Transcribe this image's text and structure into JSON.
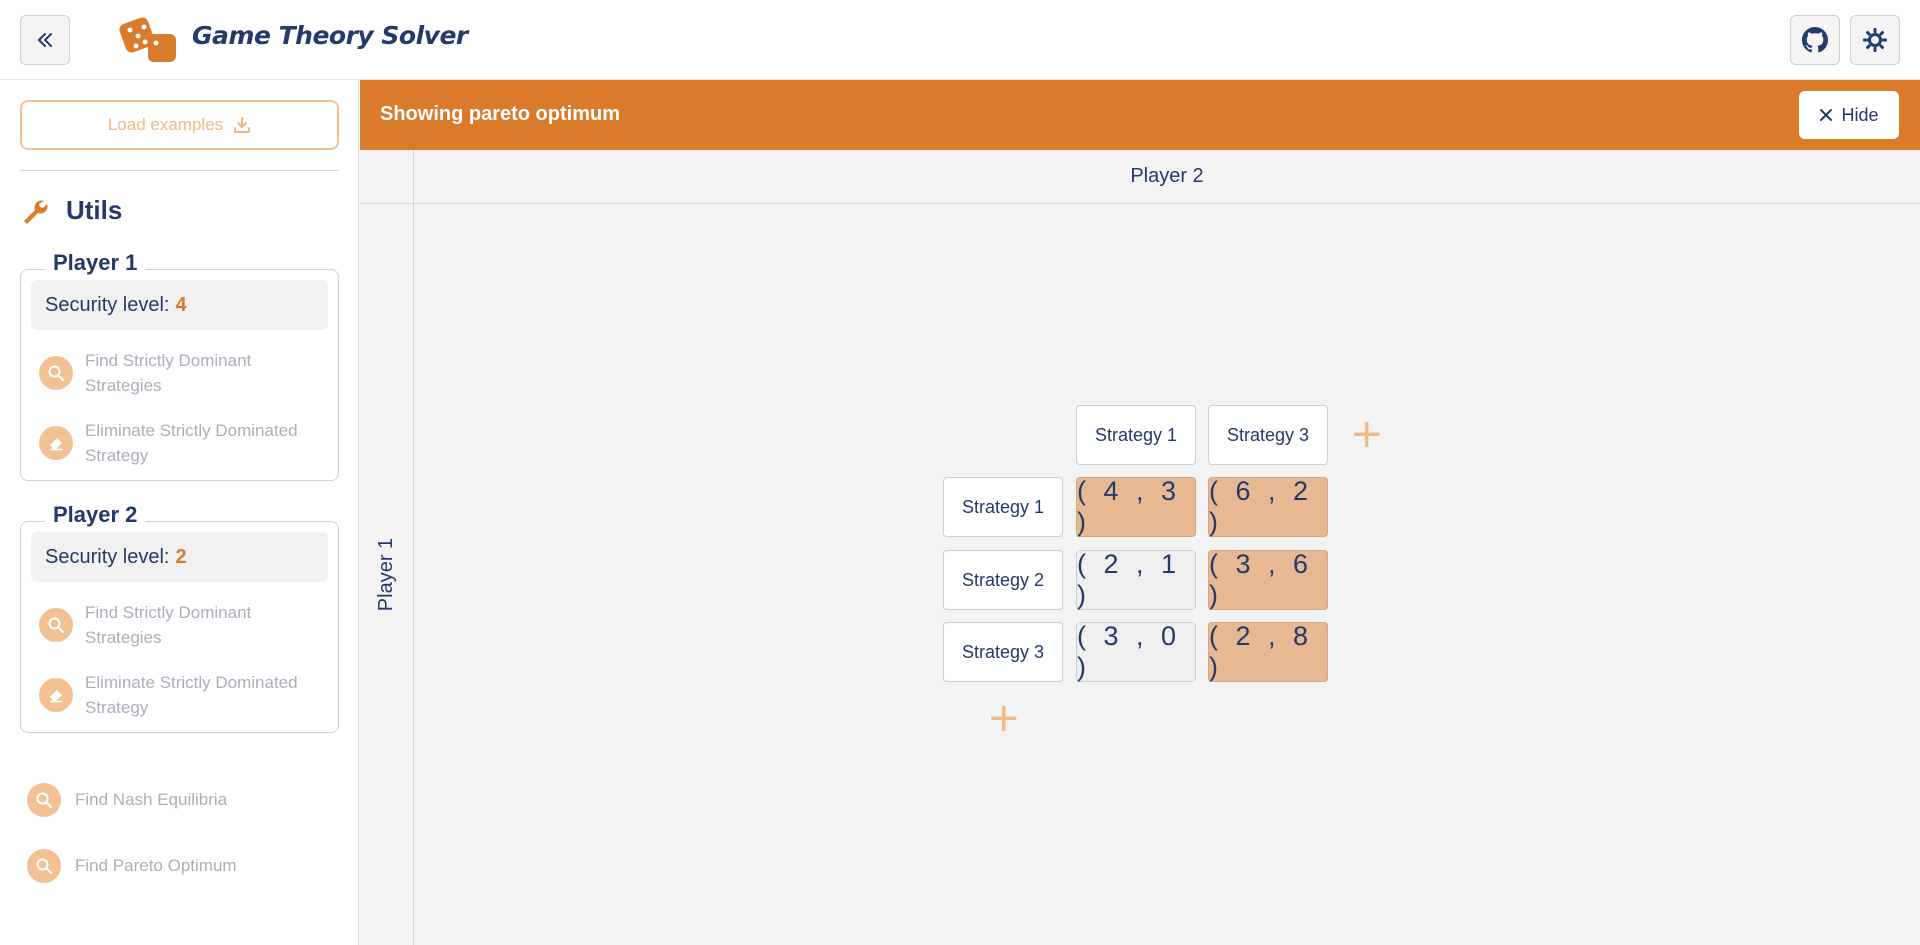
{
  "header": {
    "title": "Game Theory Solver",
    "collapse_icon": "double-chevron-left-icon",
    "github_icon": "github-icon",
    "theme_icon": "sun-gear-icon"
  },
  "sidebar": {
    "load_examples": "Load examples",
    "utils_title": "Utils",
    "players": [
      {
        "title": "Player 1",
        "security_label": "Security level:",
        "security_value": "4",
        "actions": [
          "Find Strictly Dominant Strategies",
          "Eliminate Strictly Dominated Strategy"
        ]
      },
      {
        "title": "Player 2",
        "security_label": "Security level:",
        "security_value": "2",
        "actions": [
          "Find Strictly Dominant Strategies",
          "Eliminate Strictly Dominated Strategy"
        ]
      }
    ],
    "bottom_actions": [
      "Find Nash Equilibria",
      "Find Pareto Optimum"
    ]
  },
  "banner": {
    "text": "Showing pareto optimum",
    "hide_label": "Hide"
  },
  "matrix": {
    "player2_label": "Player 2",
    "player1_label": "Player 1",
    "column_strategies": [
      "Strategy 1",
      "Strategy 3"
    ],
    "row_strategies": [
      "Strategy 1",
      "Strategy 2",
      "Strategy 3"
    ],
    "cells": [
      [
        "( 4 , 3 )",
        "( 6 , 2 )"
      ],
      [
        "( 2 , 1 )",
        "( 3 , 6 )"
      ],
      [
        "( 3 , 0 )",
        "( 2 , 8 )"
      ]
    ],
    "pareto": [
      [
        true,
        true
      ],
      [
        false,
        true
      ],
      [
        false,
        true
      ]
    ]
  },
  "colors": {
    "accent": "#d97b2a",
    "accent_light": "#f2c193",
    "pareto_cell": "#e8b892",
    "text": "#233a6b"
  }
}
